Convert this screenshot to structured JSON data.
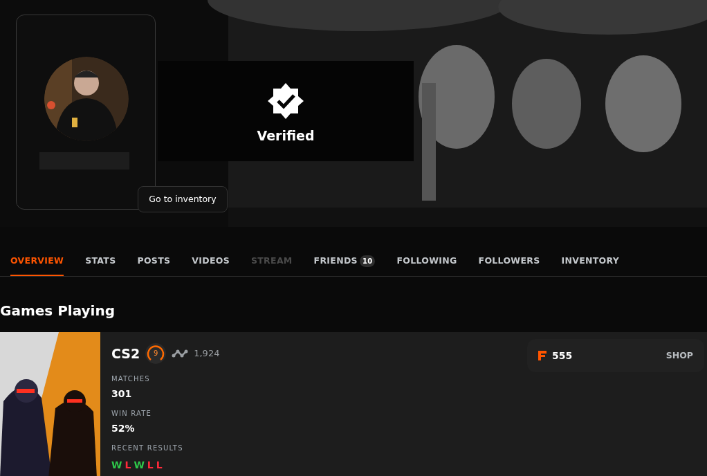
{
  "profile": {
    "verified_label": "Verified",
    "inventory_button": "Go to inventory"
  },
  "tabs": [
    {
      "label": "OVERVIEW",
      "selected": true,
      "disabled": false
    },
    {
      "label": "STATS",
      "selected": false,
      "disabled": false
    },
    {
      "label": "POSTS",
      "selected": false,
      "disabled": false
    },
    {
      "label": "VIDEOS",
      "selected": false,
      "disabled": false
    },
    {
      "label": "STREAM",
      "selected": false,
      "disabled": true
    },
    {
      "label": "FRIENDS",
      "selected": false,
      "disabled": false,
      "badge": "10"
    },
    {
      "label": "FOLLOWING",
      "selected": false,
      "disabled": false
    },
    {
      "label": "FOLLOWERS",
      "selected": false,
      "disabled": false
    },
    {
      "label": "INVENTORY",
      "selected": false,
      "disabled": false
    }
  ],
  "section_title": "Games Playing",
  "game": {
    "title": "CS2",
    "level": "9",
    "elo": "1,924",
    "stats": [
      {
        "label": "MATCHES",
        "value": "301"
      },
      {
        "label": "WIN RATE",
        "value": "52%"
      }
    ],
    "results_label": "RECENT RESULTS",
    "results": [
      {
        "letter": "W",
        "win": true
      },
      {
        "letter": "L",
        "win": false
      },
      {
        "letter": "W",
        "win": true
      },
      {
        "letter": "L",
        "win": false
      },
      {
        "letter": "L",
        "win": false
      }
    ]
  },
  "shop": {
    "points": "555",
    "link": "SHOP"
  }
}
